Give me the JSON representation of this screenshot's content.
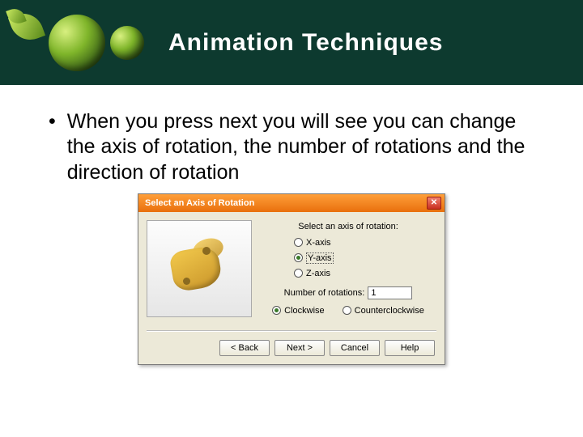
{
  "header": {
    "title": "Animation Techniques"
  },
  "bullet": {
    "text": "When you press next you will see you can change the axis of rotation, the number of rotations and the direction of rotation"
  },
  "dialog": {
    "title": "Select an Axis of Rotation",
    "prompt": "Select an axis of rotation:",
    "axes": {
      "x": "X-axis",
      "y": "Y-axis",
      "z": "Z-axis",
      "selected": "y"
    },
    "num_label": "Number of rotations:",
    "num_value": "1",
    "dir": {
      "cw": "Clockwise",
      "ccw": "Counterclockwise",
      "selected": "cw"
    },
    "buttons": {
      "back": "< Back",
      "next": "Next >",
      "cancel": "Cancel",
      "help": "Help"
    }
  }
}
